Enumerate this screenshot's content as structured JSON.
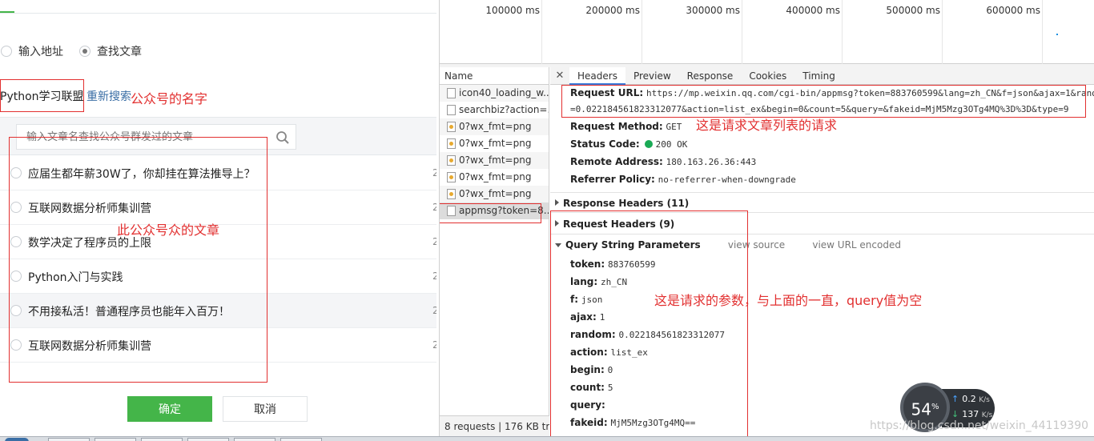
{
  "dialog": {
    "radio_options": [
      "输入地址",
      "查找文章"
    ],
    "account_name": "Python学习联盟",
    "resync_label": "重新搜索",
    "search_placeholder": "输入文章名查找公众号群发过的文章",
    "articles": [
      "应届生都年薪30W了，你却挂在算法推导上？",
      "互联网数据分析师集训营",
      "数学决定了程序员的上限",
      "Python入门与实践",
      "不用接私活！普通程序员也能年入百万！",
      "互联网数据分析师集训营"
    ],
    "ok_label": "确定",
    "cancel_label": "取消"
  },
  "annotations": {
    "account": "公众号的名字",
    "articles": "此公众号众的文章",
    "url": "这是请求文章列表的请求",
    "params": "这是请求的参数，与上面的一直，query值为空"
  },
  "devtools": {
    "timeline_ticks": [
      "100000 ms",
      "200000 ms",
      "300000 ms",
      "400000 ms",
      "500000 ms",
      "600000 ms"
    ],
    "name_header": "Name",
    "requests": [
      {
        "name": "icon40_loading_w...",
        "icon": "doc"
      },
      {
        "name": "searchbiz?action=...",
        "icon": "doc"
      },
      {
        "name": "0?wx_fmt=png",
        "icon": "img"
      },
      {
        "name": "0?wx_fmt=png",
        "icon": "img"
      },
      {
        "name": "0?wx_fmt=png",
        "icon": "img"
      },
      {
        "name": "0?wx_fmt=png",
        "icon": "img"
      },
      {
        "name": "0?wx_fmt=png",
        "icon": "img"
      },
      {
        "name": "appmsg?token=8...",
        "icon": "doc"
      }
    ],
    "footer": "8 requests | 176 KB tr...",
    "tabs": [
      "Headers",
      "Preview",
      "Response",
      "Cookies",
      "Timing"
    ],
    "general": {
      "url_label": "Request URL:",
      "url_line1": "https://mp.weixin.qq.com/cgi-bin/appmsg?token=883760599&lang=zh_CN&f=json&ajax=1&rand",
      "url_line2": "=0.022184561823312077&action=list_ex&begin=0&count=5&query=&fakeid=MjM5Mzg3OTg4MQ%3D%3D&type=9",
      "method_label": "Request Method:",
      "method": "GET",
      "status_label": "Status Code:",
      "status": "200 OK",
      "remote_label": "Remote Address:",
      "remote": "180.163.26.36:443",
      "referrer_label": "Referrer Policy:",
      "referrer": "no-referrer-when-downgrade"
    },
    "sections": {
      "response_headers": "Response Headers (11)",
      "request_headers": "Request Headers (9)",
      "query_string": "Query String Parameters",
      "view_source": "view source",
      "view_url_encoded": "view URL encoded"
    },
    "params": [
      {
        "key": "token:",
        "value": "883760599"
      },
      {
        "key": "lang:",
        "value": "zh_CN"
      },
      {
        "key": "f:",
        "value": "json"
      },
      {
        "key": "ajax:",
        "value": "1"
      },
      {
        "key": "random:",
        "value": "0.022184561823312077"
      },
      {
        "key": "action:",
        "value": "list_ex"
      },
      {
        "key": "begin:",
        "value": "0"
      },
      {
        "key": "count:",
        "value": "5"
      },
      {
        "key": "query:",
        "value": ""
      },
      {
        "key": "fakeid:",
        "value": "MjM5Mzg3OTg4MQ=="
      }
    ]
  },
  "speed_widget": {
    "percent": "54",
    "percent_unit": "%",
    "upload": "0.2",
    "download": "137",
    "unit": "K/s"
  },
  "watermark": "https://blog.csdn.net/weixin_44119390"
}
